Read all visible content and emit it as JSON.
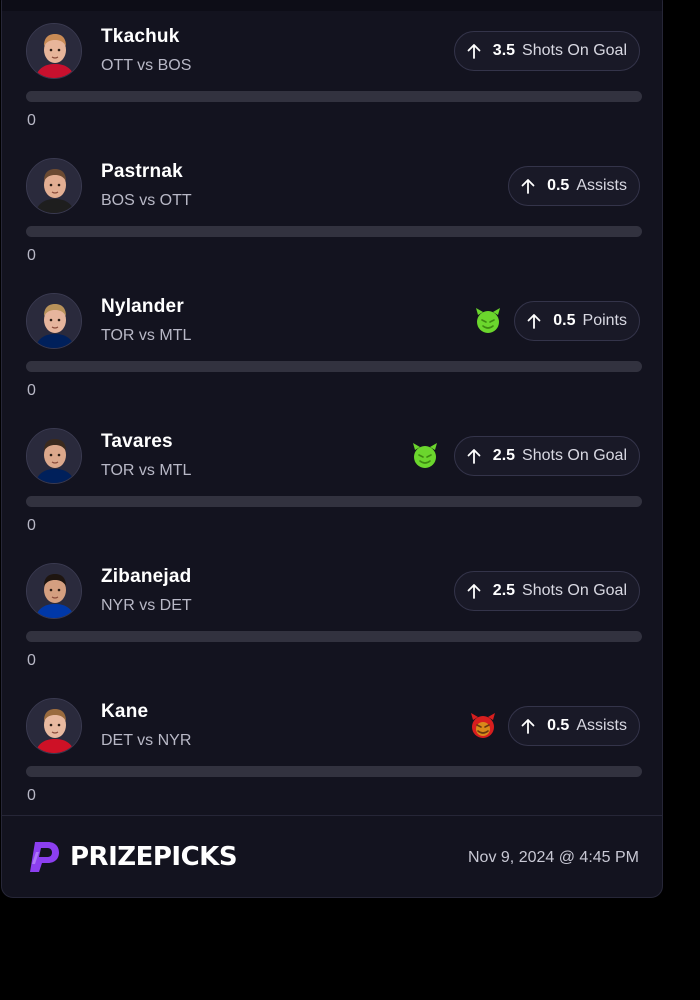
{
  "picks": [
    {
      "name": "Tkachuk",
      "matchup": "OTT vs BOS",
      "line": "3.5",
      "stat": "Shots On Goal",
      "direction": "up-arrow-icon",
      "demon": "",
      "progress": 0,
      "progress_label": "0",
      "skin": "#e7b59a",
      "hair": "#c98b55",
      "jersey": "#c8102e"
    },
    {
      "name": "Pastrnak",
      "matchup": "BOS vs OTT",
      "line": "0.5",
      "stat": "Assists",
      "direction": "up-arrow-icon",
      "demon": "",
      "progress": 0,
      "progress_label": "0",
      "skin": "#e2ae93",
      "hair": "#6b4a32",
      "jersey": "#1e1e1e"
    },
    {
      "name": "Nylander",
      "matchup": "TOR vs MTL",
      "line": "0.5",
      "stat": "Points",
      "direction": "up-arrow-icon",
      "demon": "green",
      "progress": 0,
      "progress_label": "0",
      "skin": "#e6b59d",
      "hair": "#b8925a",
      "jersey": "#00205b"
    },
    {
      "name": "Tavares",
      "matchup": "TOR vs MTL",
      "line": "2.5",
      "stat": "Shots On Goal",
      "direction": "up-arrow-icon",
      "demon": "green",
      "progress": 0,
      "progress_label": "0",
      "skin": "#dca88c",
      "hair": "#3b2a1e",
      "jersey": "#00205b"
    },
    {
      "name": "Zibanejad",
      "matchup": "NYR vs DET",
      "line": "2.5",
      "stat": "Shots On Goal",
      "direction": "up-arrow-icon",
      "demon": "",
      "progress": 0,
      "progress_label": "0",
      "skin": "#d49f80",
      "hair": "#1e1510",
      "jersey": "#0038a8"
    },
    {
      "name": "Kane",
      "matchup": "DET vs NYR",
      "line": "0.5",
      "stat": "Assists",
      "direction": "up-arrow-icon",
      "demon": "red",
      "progress": 0,
      "progress_label": "0",
      "skin": "#e8b9a0",
      "hair": "#9a6b3e",
      "jersey": "#ce1126"
    }
  ],
  "footer": {
    "brand": "PRIZEPICKS",
    "timestamp": "Nov 9, 2024 @ 4:45 PM"
  },
  "colors": {
    "background": "#13131f",
    "accent": "#7b3fe4",
    "demon_green": "#6bd62d",
    "demon_red": "#d81e1e"
  }
}
